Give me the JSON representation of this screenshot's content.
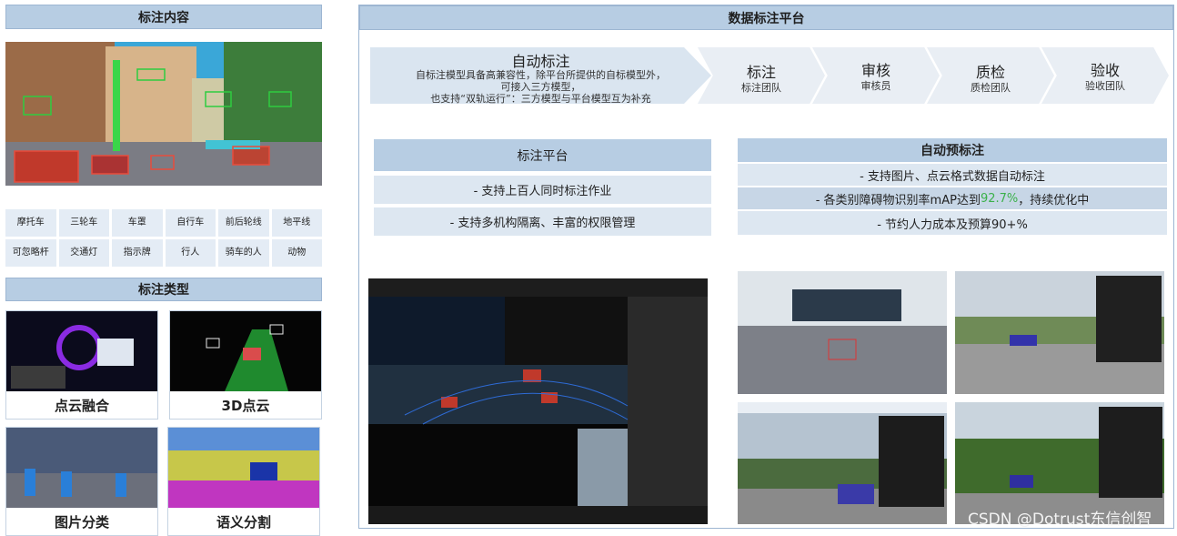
{
  "left": {
    "content_header": "标注内容",
    "tags": [
      "摩托车",
      "三轮车",
      "车罩",
      "自行车",
      "前后轮线",
      "地平线",
      "可忽略杆",
      "交通灯",
      "指示牌",
      "行人",
      "骑车的人",
      "动物"
    ],
    "types_header": "标注类型",
    "types": [
      "点云融合",
      "3D点云",
      "图片分类",
      "语义分割"
    ]
  },
  "right": {
    "header": "数据标注平台",
    "steps": [
      {
        "title": "自动标注",
        "lines": [
          "自标注模型具备高兼容性，除平台所提供的自标模型外，",
          "可接入三方模型，",
          "也支持“双轨运行”：三方模型与平台模型互为补充"
        ]
      },
      {
        "title": "标注",
        "sub": "标注团队"
      },
      {
        "title": "审核",
        "sub": "审核员"
      },
      {
        "title": "质检",
        "sub": "质检团队"
      },
      {
        "title": "验收",
        "sub": "验收团队"
      }
    ],
    "platform": {
      "title": "标注平台",
      "items": [
        "- 支持上百人同时标注作业",
        "- 支持多机构隔离、丰富的权限管理"
      ]
    },
    "auto": {
      "title": "自动预标注",
      "items_1": "- 支持图片、点云格式数据自动标注",
      "items_2_pre": "- 各类别障碍物识别率mAP达到",
      "items_2_hl": "92.7%",
      "items_2_post": "，持续优化中",
      "items_3": "- 节约人力成本及预算90+%"
    },
    "watermark": "CSDN @Dotrust东信创智"
  },
  "colors": {
    "header_bg": "#b7cde3",
    "row_bg": "#dde7f1",
    "highlight": "#3bb14a"
  }
}
